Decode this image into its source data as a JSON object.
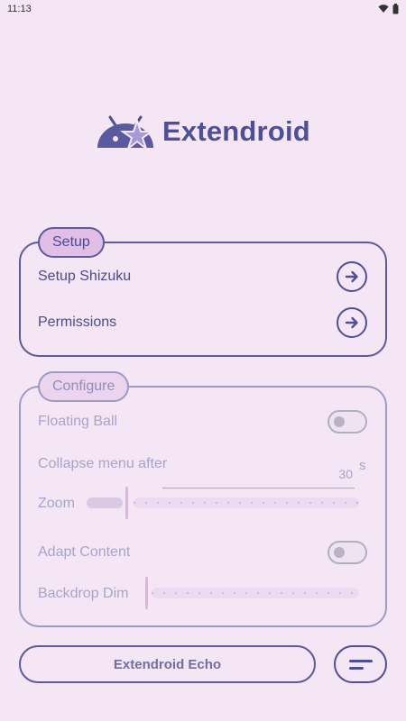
{
  "status": {
    "time": "11:13"
  },
  "app": {
    "name": "Extendroid"
  },
  "setup": {
    "legend": "Setup",
    "items": [
      {
        "label": "Setup Shizuku",
        "icon": "arrow-right-circle-icon"
      },
      {
        "label": "Permissions",
        "icon": "arrow-right-circle-icon"
      }
    ]
  },
  "configure": {
    "legend": "Configure",
    "floating_ball": {
      "label": "Floating Ball",
      "checked": false
    },
    "collapse": {
      "label": "Collapse menu after",
      "value": "30",
      "unit": "s"
    },
    "zoom": {
      "label": "Zoom",
      "value_fraction": 0.0
    },
    "adapt_content": {
      "label": "Adapt Content",
      "checked": false
    },
    "backdrop_dim": {
      "label": "Backdrop Dim",
      "value_fraction": 0.0
    }
  },
  "footer": {
    "echo_label": "Extendroid Echo",
    "menu_icon": "menu-icon"
  },
  "colors": {
    "accent": "#4f4f97",
    "background": "#f4e6f5",
    "chip": "#e2bde6"
  }
}
